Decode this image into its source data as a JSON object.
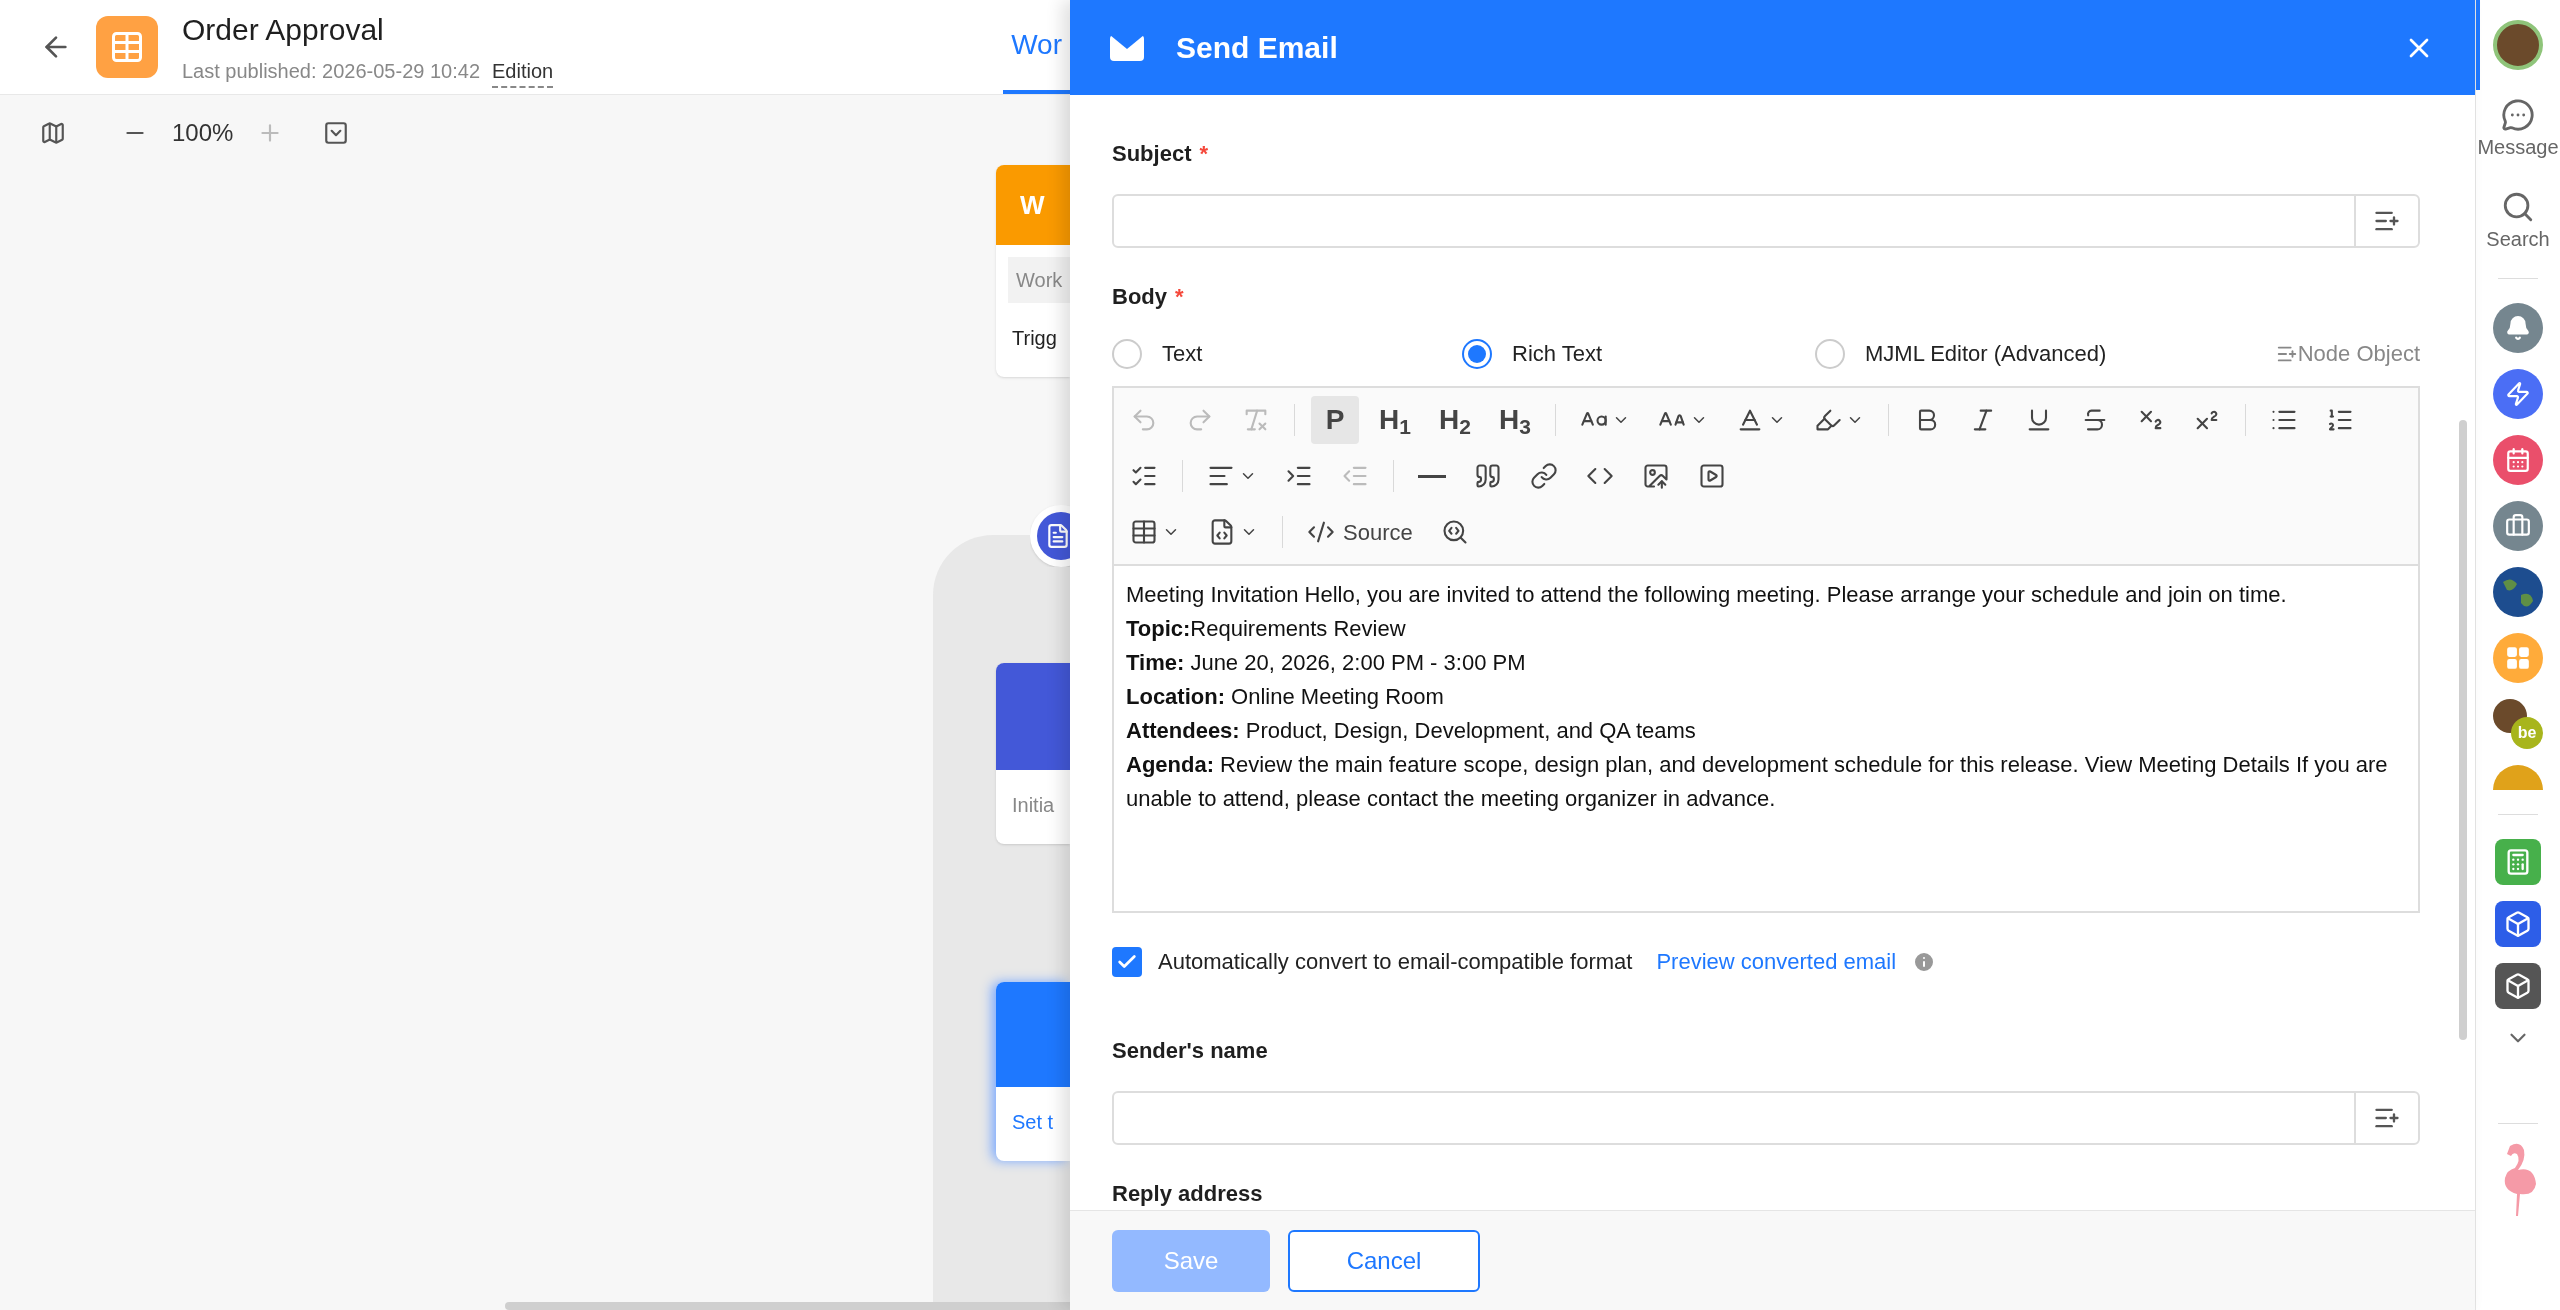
{
  "header": {
    "title": "Order Approval",
    "published": "Last published: 2026-05-29 10:42",
    "edition": "Edition",
    "tab": {
      "label": "Wor",
      "selected": true
    }
  },
  "zoom": {
    "value": "100%"
  },
  "canvas": {
    "cards": [
      {
        "kind": "trigger",
        "header": "W",
        "chip": "Work",
        "text": "Trigg"
      },
      {
        "kind": "approval",
        "text": "Initia"
      },
      {
        "kind": "action",
        "text": "Set t",
        "selected": true
      }
    ]
  },
  "drawer": {
    "title": "Send Email",
    "required_mark": "*",
    "subject": {
      "label": "Subject",
      "required": true
    },
    "body": {
      "label": "Body",
      "required": true,
      "modes": [
        {
          "label": "Text",
          "selected": false
        },
        {
          "label": "Rich Text",
          "selected": true
        },
        {
          "label": "MJML Editor (Advanced)",
          "selected": false
        }
      ],
      "node_object": "Node Object",
      "toolbar": [
        [
          {
            "kind": "undo",
            "disabled": true
          },
          {
            "kind": "redo",
            "disabled": true
          },
          {
            "kind": "clear",
            "disabled": true
          },
          {
            "kind": "sep"
          },
          {
            "kind": "paragraph",
            "label": "P",
            "selected": true
          },
          {
            "kind": "heading",
            "label": "H$_{1}$",
            "selected": false
          },
          {
            "kind": "heading",
            "label": "H$_{2}$",
            "selected": false
          },
          {
            "kind": "heading",
            "label": "H$_{3}$",
            "selected": false
          },
          {
            "kind": "sep"
          },
          {
            "kind": "font_family",
            "disabled": false
          },
          {
            "kind": "font_size",
            "disabled": false
          },
          {
            "kind": "font_color",
            "disabled": false
          },
          {
            "kind": "highlight",
            "disabled": false
          },
          {
            "kind": "sep"
          },
          {
            "kind": "bold",
            "disabled": false
          },
          {
            "kind": "italic",
            "disabled": false
          },
          {
            "kind": "underline",
            "disabled": false
          },
          {
            "kind": "strike",
            "disabled": false
          },
          {
            "kind": "subscript",
            "disabled": false
          },
          {
            "kind": "superscript",
            "disabled": false
          },
          {
            "kind": "sep"
          },
          {
            "kind": "bullet_list",
            "disabled": false
          },
          {
            "kind": "ordered_list",
            "disabled": false
          }
        ],
        [
          {
            "kind": "task_list",
            "disabled": false
          },
          {
            "kind": "sep"
          },
          {
            "kind": "align",
            "disabled": false
          },
          {
            "kind": "indent",
            "disabled": false
          },
          {
            "kind": "outdent",
            "disabled": true
          },
          {
            "kind": "sep"
          },
          {
            "kind": "rule",
            "disabled": false
          },
          {
            "kind": "quote",
            "disabled": false
          },
          {
            "kind": "link",
            "disabled": false
          },
          {
            "kind": "code",
            "disabled": false
          },
          {
            "kind": "image",
            "disabled": false
          },
          {
            "kind": "video",
            "disabled": false
          }
        ],
        [
          {
            "kind": "table",
            "disabled": false
          },
          {
            "kind": "template",
            "disabled": false
          },
          {
            "kind": "sep"
          },
          {
            "kind": "source",
            "label": "Source",
            "disabled": false
          },
          {
            "kind": "find",
            "disabled": false
          }
        ]
      ],
      "paragraphs": [
        "Meeting Invitation Hello, you are invited to attend the following meeting. Please arrange your schedule and join on time.",
        "**Topic:**Requirements Review",
        "**Time:** June 20, 2026, 2:00 PM - 3:00 PM",
        "**Location:** Online Meeting Room",
        "**Attendees:** Product, Design, Development, and QA teams",
        "**Agenda:** Review the main feature scope, design plan, and development schedule for this release. View Meeting Details If you are unable to attend, please contact the meeting organizer in advance."
      ]
    },
    "convert": {
      "checked": true,
      "label": "Automatically convert to email-compatible format",
      "link": "Preview converted email"
    },
    "sender": {
      "label": "Sender's name"
    },
    "reply": {
      "label": "Reply address"
    },
    "save": {
      "label": "Save",
      "disabled": true
    },
    "cancel": {
      "label": "Cancel"
    }
  },
  "sidebar": {
    "items": [
      {
        "label": "Message"
      },
      {
        "label": "Search"
      }
    ],
    "badge": "be"
  }
}
